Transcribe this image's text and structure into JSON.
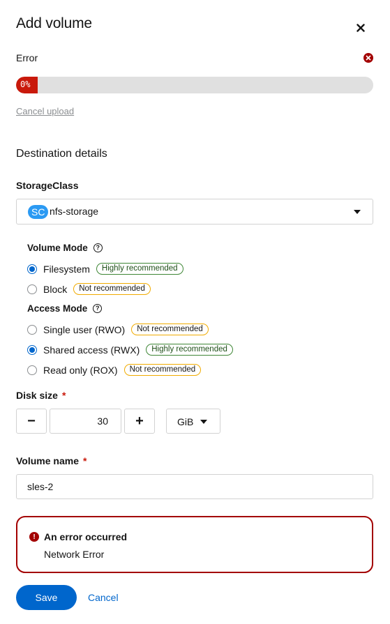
{
  "modal": {
    "title": "Add volume",
    "close_icon": "close-icon"
  },
  "upload": {
    "status": "Error",
    "status_icon": "error-circle-icon",
    "progress_percent": 0,
    "progress_label": "0%",
    "cancel_label": "Cancel upload"
  },
  "destination": {
    "title": "Destination details",
    "storage_class": {
      "label": "StorageClass",
      "badge": "SC",
      "value": "nfs-storage"
    },
    "volume_mode": {
      "label": "Volume Mode",
      "options": [
        {
          "label": "Filesystem",
          "badge": "Highly recommended",
          "checked": true
        },
        {
          "label": "Block",
          "badge": "Not recommended",
          "checked": false
        }
      ]
    },
    "access_mode": {
      "label": "Access Mode",
      "options": [
        {
          "label": "Single user (RWO)",
          "badge": "Not recommended",
          "checked": false
        },
        {
          "label": "Shared access (RWX)",
          "badge": "Highly recommended",
          "checked": true
        },
        {
          "label": "Read only (ROX)",
          "badge": "Not recommended",
          "checked": false
        }
      ]
    },
    "disk_size": {
      "label": "Disk size",
      "required_mark": "*",
      "minus": "−",
      "plus": "+",
      "value": "30",
      "unit": "GiB"
    },
    "volume_name": {
      "label": "Volume name",
      "required_mark": "*",
      "value": "sles-2"
    }
  },
  "alert": {
    "title": "An error occurred",
    "body": "Network Error",
    "icon": "exclamation-circle-icon"
  },
  "actions": {
    "save": "Save",
    "cancel": "Cancel"
  },
  "colors": {
    "primary": "#0066cc",
    "danger": "#c9190b",
    "success_border": "#3e8635",
    "warning_border": "#f0ab00"
  }
}
